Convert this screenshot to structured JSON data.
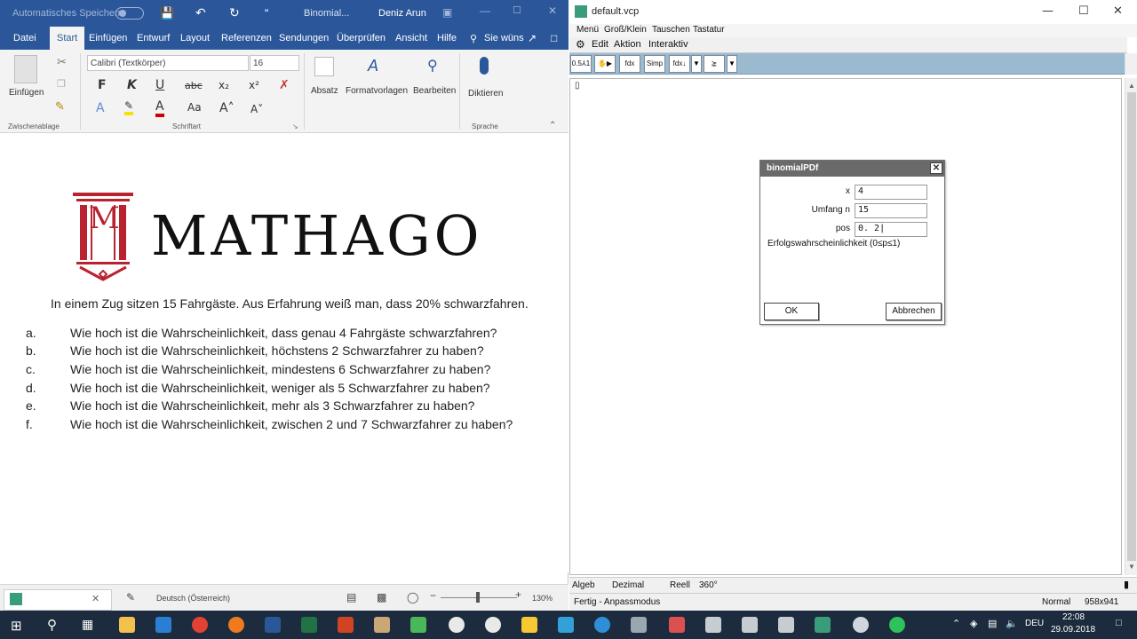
{
  "word": {
    "autosave_label": "Automatisches Speichern",
    "quick_more": "“",
    "doc_title": "Binomial...",
    "user_name": "Deniz Arun",
    "tabs": [
      "Datei",
      "Start",
      "Einfügen",
      "Entwurf",
      "Layout",
      "Referenzen",
      "Sendungen",
      "Überprüfen",
      "Ansicht",
      "Hilfe"
    ],
    "tell_me": "Sie wüns",
    "ribbon": {
      "paste_label": "Einfügen",
      "clipboard_group": "Zwischenablage",
      "font_name": "Calibri (Textkörper)",
      "font_size": "16",
      "bold": "F",
      "italic": "K",
      "underline": "U",
      "strike": "abc",
      "subscript": "x₂",
      "superscript": "x²",
      "font_color_glyph": "A",
      "case_label": "Aa",
      "grow_font": "A˄",
      "shrink_font": "A˅",
      "font_group": "Schriftart",
      "paragraph_label": "Absatz",
      "styles_label": "Formatvorlagen",
      "edit_label": "Bearbeiten",
      "dictate_label": "Diktieren",
      "voice_group": "Sprache"
    },
    "document": {
      "logo_text": "MATHAGO",
      "logo_letter": "M",
      "intro": "In einem Zug sitzen 15 Fahrgäste. Aus Erfahrung weiß man, dass 20% schwarzfahren.",
      "questions": [
        {
          "letter": "a.",
          "text": "Wie hoch ist die Wahrscheinlichkeit, dass genau 4 Fahrgäste schwarzfahren?"
        },
        {
          "letter": "b.",
          "text": "Wie hoch ist die Wahrscheinlichkeit, höchstens 2 Schwarzfahrer zu haben?"
        },
        {
          "letter": "c.",
          "text": "Wie hoch ist die Wahrscheinlichkeit, mindestens 6 Schwarzfahrer zu haben?"
        },
        {
          "letter": "d.",
          "text": "Wie hoch ist die Wahrscheinlichkeit, weniger als 5 Schwarzfahrer zu haben?"
        },
        {
          "letter": "e.",
          "text": "Wie hoch ist die Wahrscheinlichkeit, mehr als 3 Schwarzfahrer zu haben?"
        },
        {
          "letter": "f.",
          "text": "Wie hoch ist die Wahrscheinlichkeit, zwischen 2 und 7 Schwarzfahrer zu haben?"
        }
      ]
    },
    "status": {
      "language": "Deutsch (Österreich)",
      "zoom_minus": "−",
      "zoom_plus": "+",
      "zoom": "130%"
    }
  },
  "classpad": {
    "title": "default.vcp",
    "menu": [
      "Menü",
      "Groß/Klein",
      "Tauschen",
      "Tastatur"
    ],
    "menu2": [
      "Edit",
      "Aktion",
      "Interaktiv"
    ],
    "toolbar": [
      "0.5⅄1",
      "✋▶",
      "fdx",
      "Simp",
      "fdx↓",
      "▼",
      "⪲",
      "▼"
    ],
    "cursor": "▯",
    "status_line": [
      "Algeb",
      "Dezimal",
      "Reell",
      "360°"
    ],
    "footer": {
      "state": "Fertig - Anpassmodus",
      "mode": "Normal",
      "size": "958x941"
    },
    "dialog": {
      "title": "binomialPDf",
      "close": "✕",
      "fields": [
        {
          "label": "x",
          "value": "4"
        },
        {
          "label": "Umfang n",
          "value": "15"
        },
        {
          "label": "pos",
          "value": "0. 2|"
        }
      ],
      "hint": "Erfolgswahrscheinlichkeit (0≤p≤1)",
      "ok": "OK",
      "cancel": "Abbrechen"
    }
  },
  "taskbar": {
    "language": "DEU",
    "time": "22:08",
    "date": "29.09.2018"
  },
  "colors": {
    "word_blue": "#2b579a",
    "logo_red": "#b8232f",
    "taskbar": "#1c2b3d",
    "cp_toolbar": "#9bbad0"
  }
}
